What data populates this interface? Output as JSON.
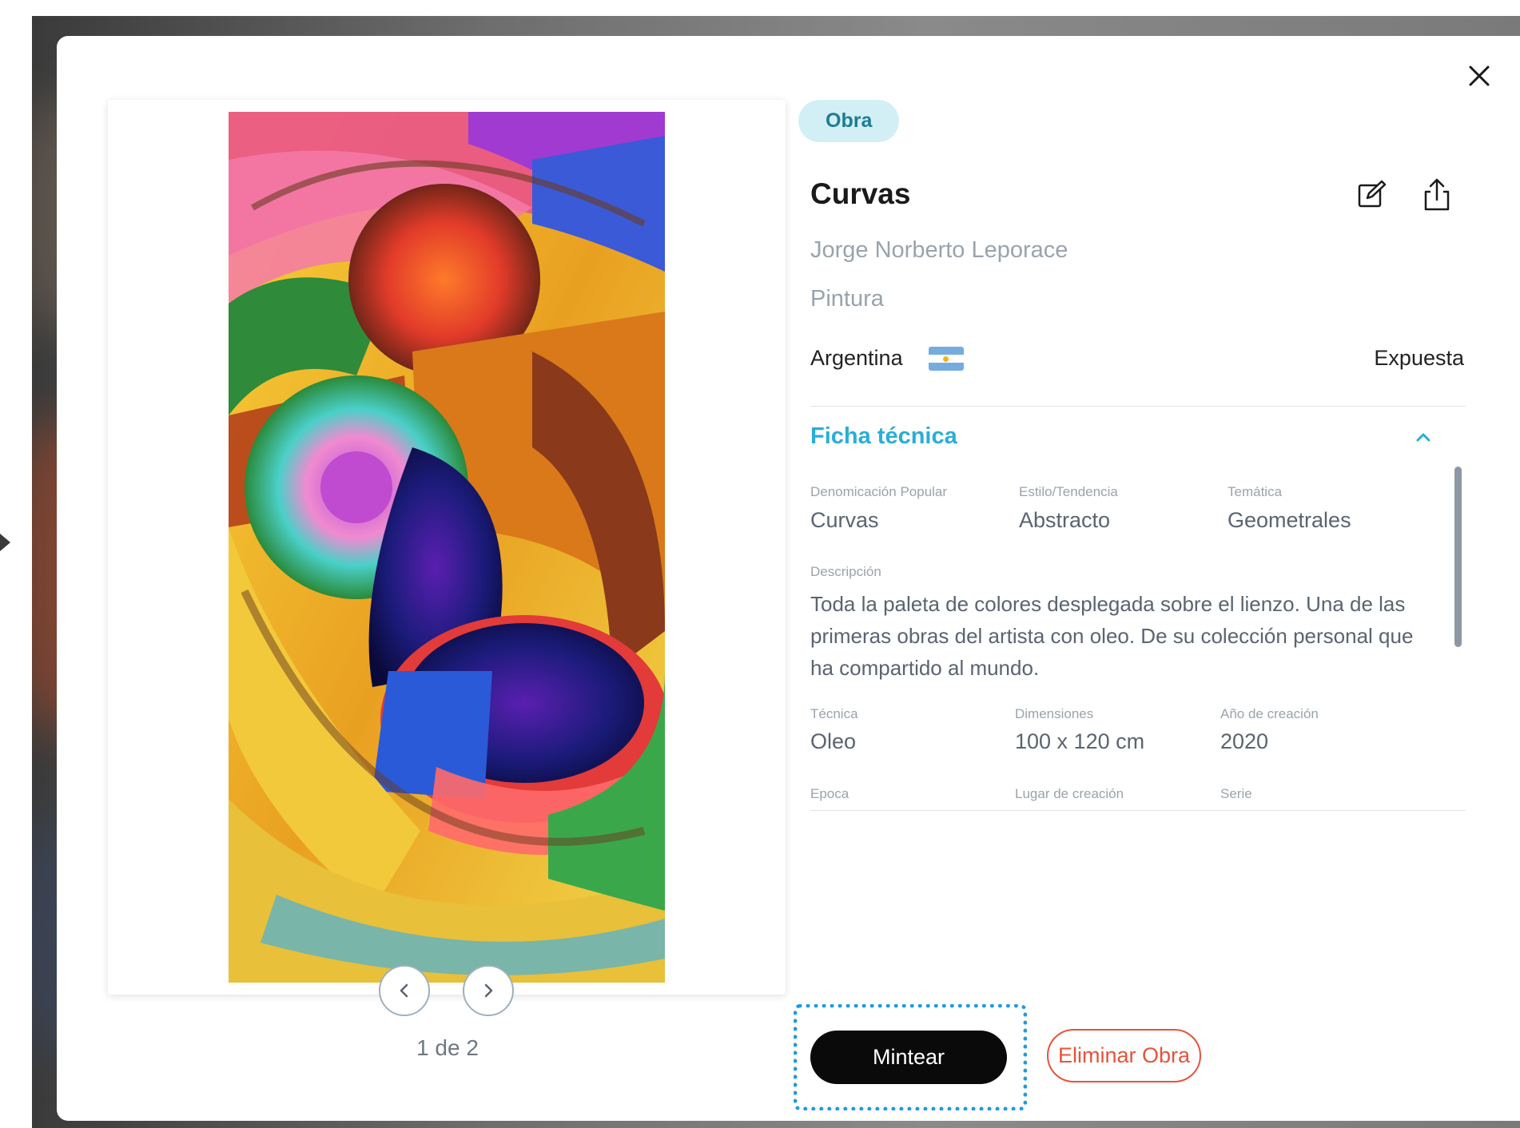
{
  "work": {
    "tag": "Obra",
    "title": "Curvas",
    "artist": "Jorge Norberto Leporace",
    "category": "Pintura",
    "country": "Argentina",
    "status": "Expuesta"
  },
  "gallery": {
    "pager": "1 de 2"
  },
  "ficha": {
    "title": "Ficha técnica",
    "fields": [
      {
        "label": "Denomicación Popular",
        "value": "Curvas"
      },
      {
        "label": "Estilo/Tendencia",
        "value": "Abstracto"
      },
      {
        "label": "Temática",
        "value": "Geometrales"
      },
      {
        "label": "Técnica",
        "value": "Oleo"
      },
      {
        "label": "Dimensiones",
        "value": "100 x 120 cm"
      },
      {
        "label": "Año de creación",
        "value": "2020"
      },
      {
        "label": "Epoca",
        "value": ""
      },
      {
        "label": "Lugar de creación",
        "value": ""
      },
      {
        "label": "Serie",
        "value": ""
      }
    ],
    "description_label": "Descripción",
    "description": "Toda la paleta de colores desplegada sobre el lienzo. Una de las primeras obras del artista con oleo. De su colección personal que ha compartido al mundo."
  },
  "actions": {
    "mint": "Mintear",
    "delete": "Eliminar Obra"
  },
  "colors": {
    "accent": "#2aaed7",
    "tag_bg": "#d3eff6",
    "danger": "#e6533c",
    "focus": "#1e9be0"
  }
}
